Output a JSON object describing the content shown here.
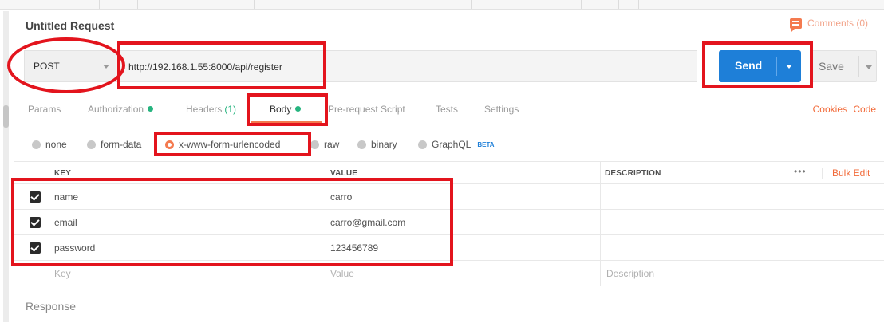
{
  "request": {
    "title": "Untitled Request",
    "comments_label": "Comments (0)"
  },
  "url_bar": {
    "method": "POST",
    "url": "http://192.168.1.55:8000/api/register",
    "send_label": "Send",
    "save_label": "Save"
  },
  "tabs": {
    "params": "Params",
    "authorization": "Authorization",
    "headers": "Headers",
    "headers_count": "(1)",
    "body": "Body",
    "prerequest": "Pre-request Script",
    "tests": "Tests",
    "settings": "Settings",
    "cookies": "Cookies",
    "code": "Code"
  },
  "body_types": {
    "none": "none",
    "form_data": "form-data",
    "urlencoded": "x-www-form-urlencoded",
    "raw": "raw",
    "binary": "binary",
    "graphql": "GraphQL",
    "graphql_badge": "BETA",
    "selected": "x-www-form-urlencoded"
  },
  "params_table": {
    "headers": {
      "key": "KEY",
      "value": "VALUE",
      "description": "DESCRIPTION"
    },
    "more": "•••",
    "bulk_edit": "Bulk Edit",
    "rows": [
      {
        "key": "name",
        "value": "carro"
      },
      {
        "key": "email",
        "value": "carro@gmail.com"
      },
      {
        "key": "password",
        "value": "123456789"
      }
    ],
    "placeholder": {
      "key": "Key",
      "value": "Value",
      "description": "Description"
    }
  },
  "response": {
    "label": "Response"
  },
  "colors": {
    "accent": "#f47a4f",
    "send": "#1e7fd8",
    "status_dot": "#26b47f",
    "annotation": "#e3141d"
  }
}
